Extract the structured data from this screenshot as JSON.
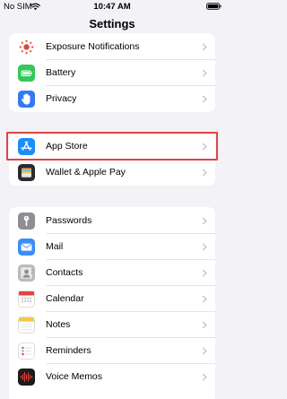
{
  "status_bar": {
    "carrier": "No SIM",
    "time": "10:47 AM",
    "wifi_icon": "wifi-icon",
    "battery_icon": "battery-status-icon"
  },
  "header": {
    "title": "Settings"
  },
  "groups": [
    {
      "items": [
        {
          "label": "Exposure Notifications",
          "icon": "exposure-notifications-icon",
          "icon_bg": "#ffffff",
          "icon_fg": "#e8433a"
        },
        {
          "label": "Battery",
          "icon": "battery-icon",
          "icon_bg": "#34c759",
          "icon_fg": "#ffffff"
        },
        {
          "label": "Privacy",
          "icon": "hand-icon",
          "icon_bg": "#3478f6",
          "icon_fg": "#ffffff"
        }
      ]
    },
    {
      "items": [
        {
          "label": "App Store",
          "icon": "app-store-icon",
          "icon_bg": "#1a8cfb",
          "icon_fg": "#ffffff",
          "highlighted": true
        },
        {
          "label": "Wallet & Apple Pay",
          "icon": "wallet-icon",
          "icon_bg": "#2c2c2e",
          "icon_fg": "#ffffff"
        }
      ]
    },
    {
      "items": [
        {
          "label": "Passwords",
          "icon": "key-icon",
          "icon_bg": "#8e8e93",
          "icon_fg": "#ffffff"
        },
        {
          "label": "Mail",
          "icon": "mail-icon",
          "icon_bg": "#3a8ef6",
          "icon_fg": "#ffffff"
        },
        {
          "label": "Contacts",
          "icon": "contacts-icon",
          "icon_bg": "#b9b9be",
          "icon_fg": "#7a7a7f"
        },
        {
          "label": "Calendar",
          "icon": "calendar-icon",
          "icon_bg": "#ffffff",
          "icon_fg": "#e8433a"
        },
        {
          "label": "Notes",
          "icon": "notes-icon",
          "icon_bg": "#ffffff",
          "icon_fg": "#f7c844"
        },
        {
          "label": "Reminders",
          "icon": "reminders-icon",
          "icon_bg": "#ffffff",
          "icon_fg": "#3a8ef6"
        },
        {
          "label": "Voice Memos",
          "icon": "voice-memos-icon",
          "icon_bg": "#1c1c1e",
          "icon_fg": "#e8433a"
        }
      ]
    }
  ],
  "colors": {
    "background": "#f2f2f7",
    "highlight_border": "#e04444",
    "chevron": "#c4c4c7"
  }
}
